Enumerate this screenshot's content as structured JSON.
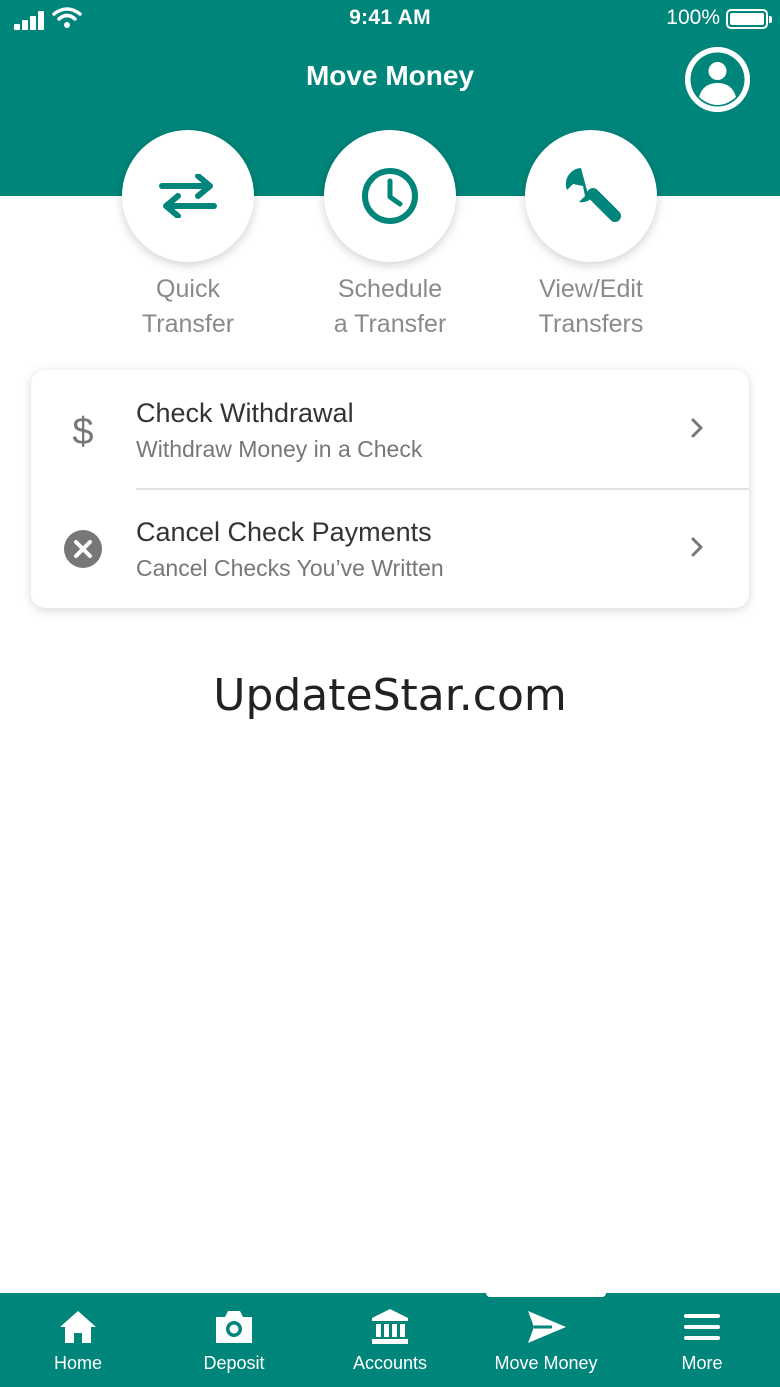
{
  "status_bar": {
    "time": "9:41 AM",
    "battery": "100%"
  },
  "header": {
    "title": "Move Money"
  },
  "icons": {
    "profile": "user-circle-icon",
    "quick_transfer": "swap-arrows-icon",
    "schedule": "clock-icon",
    "view_edit": "wrench-icon",
    "check_withdrawal": "dollar-icon",
    "cancel_check": "close-circle-icon",
    "chevron": "chevron-right-icon"
  },
  "actions": [
    {
      "label": "Quick\nTransfer"
    },
    {
      "label": "Schedule\na Transfer"
    },
    {
      "label": "View/Edit\nTransfers"
    }
  ],
  "check_options": [
    {
      "title": "Check Withdrawal",
      "subtitle": "Withdraw Money in a Check"
    },
    {
      "title": "Cancel Check Payments",
      "subtitle": "Cancel Checks You’ve Written"
    }
  ],
  "watermark": "UpdateStar.com",
  "tabbar": {
    "items": [
      {
        "label": "Home",
        "icon": "home-icon"
      },
      {
        "label": "Deposit",
        "icon": "camera-icon"
      },
      {
        "label": "Accounts",
        "icon": "bank-icon"
      },
      {
        "label": "Move Money",
        "icon": "send-icon"
      },
      {
        "label": "More",
        "icon": "menu-icon"
      }
    ],
    "active": "Move Money"
  },
  "colors": {
    "brand": "#00857a",
    "label_gray": "#8a8a8a",
    "text_dark": "#333333"
  }
}
